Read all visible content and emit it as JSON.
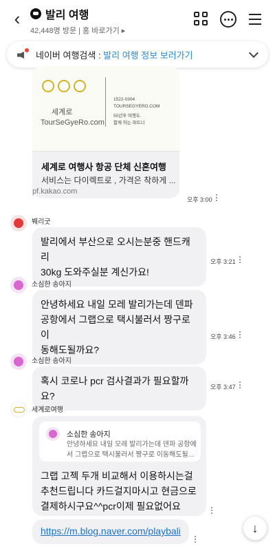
{
  "header": {
    "title": "발리 여행",
    "visits": "42,448명 방문",
    "home_link": "홈 바로가기",
    "home_arrow": "▸",
    "back_glyph": "‹"
  },
  "notice": {
    "label": "네이버 여행검색 : ",
    "link": "발리 여행 정보 보러가기"
  },
  "card": {
    "logo_kr": "세계로",
    "logo_url": "TourSeGyeRo.com",
    "info_lines": [
      "1522-0304",
      "TOURSEGYERO.COM",
      "50년후 여행도",
      "함께 하는 파트너"
    ],
    "title": "세계로 여행사 항공 단체 신혼여행",
    "desc": "서비스는 다이렉트로 , 가격은 착하게 ...",
    "domain": "pf.kakao.com",
    "time": "오후 3:00"
  },
  "messages": [
    {
      "sender": "붸리굿",
      "text": "발리에서 부산으로 오시는분중 핸드캐리\n30kg 도와주실분 계신가요!",
      "time": "오후 3:21"
    },
    {
      "sender": "소심한 송아지",
      "text": "안녕하세요 내일 모레 발리가는데 덴파\n공항에서 그랩으로 택시불러서 짱구로 이\n동해도될까요?",
      "time": "오후 3:46"
    },
    {
      "sender": "소심한 송아지",
      "text": "혹시 코로나 pcr 검사결과가 필요할까요?",
      "time": "오후 3:47"
    },
    {
      "sender": "세계로여행",
      "quote_name": "소심한 송아지",
      "quote_text": "안녕하세요 내일 모레 발리가는데 덴파 공항에서 그랩으로 택시불러서 짱구로 이동해도될...",
      "text": "그랩 고젝 두개 비교해서 이용하시는걸\n추천드립니다 카드걸지마시고 현금으로\n결제하시구요^^pcr이제 필요없어요"
    }
  ],
  "link_message": "https://m.blog.naver.com/playbali",
  "scroll_glyph": "↓"
}
